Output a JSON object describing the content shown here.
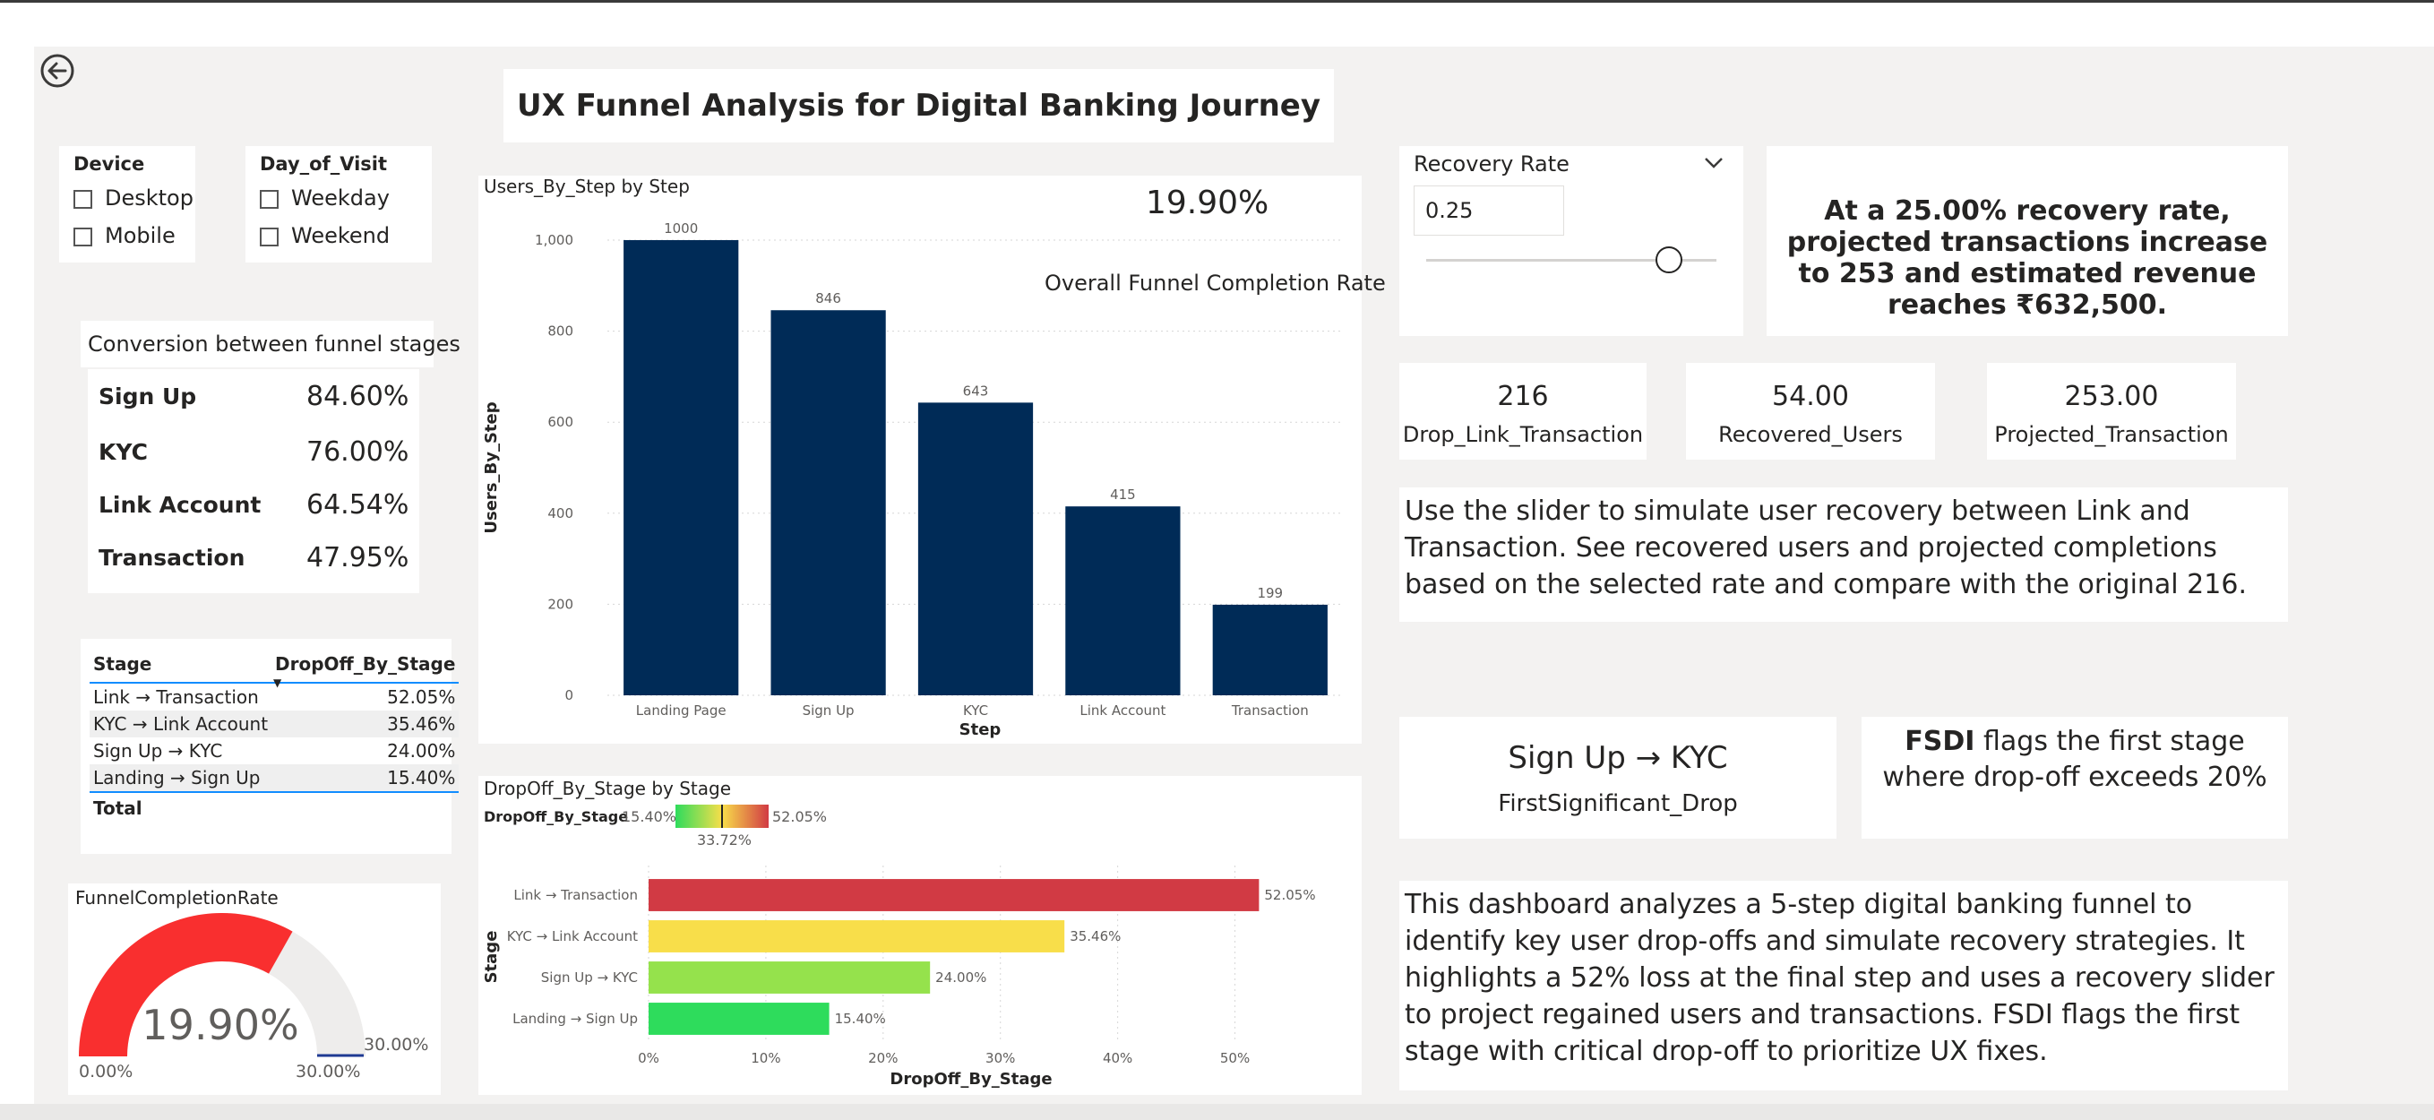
{
  "header": {
    "title": "UX Funnel Analysis for Digital Banking Journey",
    "back_icon": "back-arrow-icon"
  },
  "slicers": {
    "device": {
      "title": "Device",
      "options": [
        "Desktop",
        "Mobile"
      ]
    },
    "day": {
      "title": "Day_of_Visit",
      "options": [
        "Weekday",
        "Weekend"
      ]
    }
  },
  "conversion": {
    "title": "Conversion between funnel stages",
    "rows": [
      {
        "label": "Sign Up",
        "value": "84.60%"
      },
      {
        "label": "KYC",
        "value": "76.00%"
      },
      {
        "label": "Link Account",
        "value": "64.54%"
      },
      {
        "label": "Transaction",
        "value": "47.95%"
      }
    ]
  },
  "dropoff_table": {
    "headers": [
      "Stage",
      "DropOff_By_Stage"
    ],
    "rows": [
      {
        "stage": "Link → Transaction",
        "value": "52.05%"
      },
      {
        "stage": "KYC → Link Account",
        "value": "35.46%"
      },
      {
        "stage": "Sign Up → KYC",
        "value": "24.00%"
      },
      {
        "stage": "Landing → Sign Up",
        "value": "15.40%"
      }
    ],
    "total_label": "Total"
  },
  "gauge": {
    "title": "FunnelCompletionRate",
    "value_text": "19.90%",
    "value": 0.199,
    "min_label": "0.00%",
    "max_label": "30.00%",
    "target_label": "30.00%",
    "fill_color": "#f92f2f"
  },
  "users_chart": {
    "title": "Users_By_Step by Step",
    "card_value": "19.90%",
    "card_label": "Overall Funnel Completion Rate"
  },
  "dropoff_chart": {
    "title": "DropOff_By_Stage by Stage",
    "legend_label": "DropOff_By_Stage",
    "legend_min": "15.40%",
    "legend_mid": "33.72%",
    "legend_max": "52.05%"
  },
  "chart_data": [
    {
      "type": "bar",
      "title": "Users_By_Step by Step",
      "xlabel": "Step",
      "ylabel": "Users_By_Step",
      "categories": [
        "Landing Page",
        "Sign Up",
        "KYC",
        "Link Account",
        "Transaction"
      ],
      "values": [
        1000,
        846,
        643,
        415,
        199
      ],
      "value_labels": [
        "1000",
        "846",
        "643",
        "415",
        "199"
      ],
      "ylim": [
        0,
        1000
      ],
      "yticks": [
        0,
        200,
        400,
        600,
        800,
        1000
      ],
      "ytick_labels": [
        "0",
        "200",
        "400",
        "600",
        "800",
        "1,000"
      ],
      "color": "#002b57",
      "grid": true
    },
    {
      "type": "bar",
      "orientation": "horizontal",
      "title": "DropOff_By_Stage by Stage",
      "xlabel": "DropOff_By_Stage",
      "ylabel": "Stage",
      "categories": [
        "Link → Transaction",
        "KYC → Link Account",
        "Sign Up → KYC",
        "Landing → Sign Up"
      ],
      "values": [
        52.05,
        35.46,
        24.0,
        15.4
      ],
      "value_labels": [
        "52.05%",
        "35.46%",
        "24.00%",
        "15.40%"
      ],
      "colors": [
        "#d13a44",
        "#f8de4a",
        "#95e24c",
        "#2edc5c"
      ],
      "xlim": [
        0,
        55
      ],
      "xticks": [
        0,
        10,
        20,
        30,
        40,
        50
      ],
      "xtick_labels": [
        "0%",
        "10%",
        "20%",
        "30%",
        "40%",
        "50%"
      ],
      "grid": true
    }
  ],
  "recovery": {
    "title": "Recovery Rate",
    "input_value": "0.25",
    "slider_value": 0.25,
    "chevron_icon": "chevron-down-icon",
    "summary": "At a 25.00% recovery rate, projected transactions increase to 253 and estimated revenue reaches ₹632,500."
  },
  "kpis": [
    {
      "value": "216",
      "label": "Drop_Link_Transaction"
    },
    {
      "value": "54.00",
      "label": "Recovered_Users"
    },
    {
      "value": "253.00",
      "label": "Projected_Transaction"
    }
  ],
  "slider_text": "Use the slider to simulate user recovery between Link and Transaction. See recovered users and projected completions based on the selected rate and compare with the original 216.",
  "fsd": {
    "value": "Sign Up → KYC",
    "label": "FirstSignificant_Drop",
    "note_bold": "FSDI",
    "note_rest": " flags the first stage where drop-off exceeds 20%"
  },
  "description": "This dashboard analyzes a 5-step digital banking funnel to identify key user drop-offs and simulate recovery strategies. It highlights a 52% loss at the final step and uses a recovery slider to project regained users and transactions. FSDI flags the first stage with critical drop-off to prioritize UX fixes."
}
